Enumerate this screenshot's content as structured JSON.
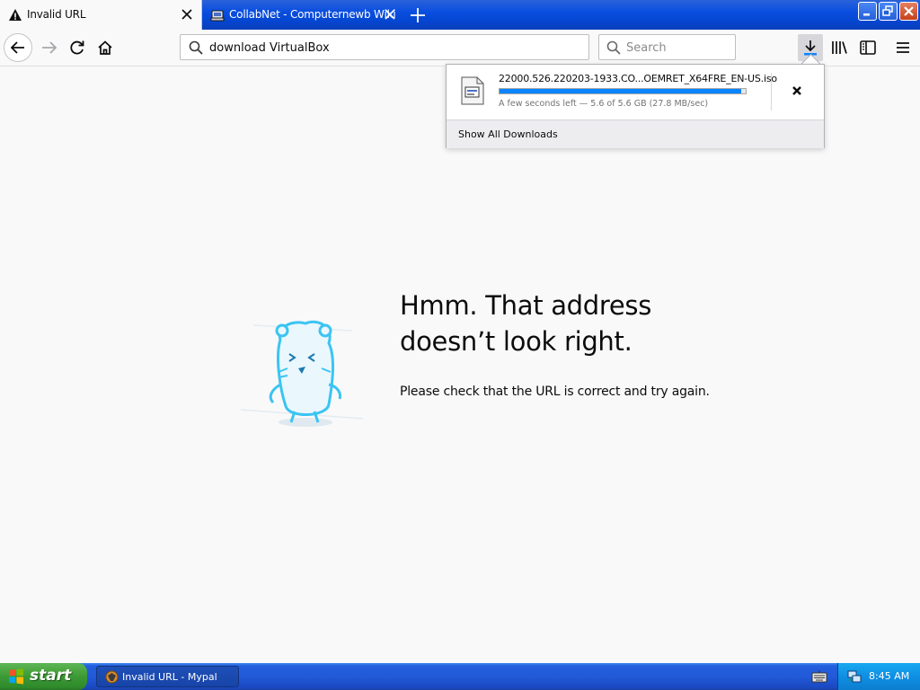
{
  "browser": {
    "tabs": [
      {
        "title": "Invalid URL",
        "icon": "warning-icon",
        "active": true
      },
      {
        "title": "CollabNet - Computernewb Wiki",
        "icon": "wiki-favicon-icon",
        "active": false
      }
    ],
    "url": "download VirtualBox",
    "search_placeholder": "Search"
  },
  "downloads_panel": {
    "filename": "22000.526.220203-1933.CO...OEMRET_X64FRE_EN-US.iso",
    "progress": 0.98,
    "status": "A few seconds left — 5.6 of 5.6 GB (27.8 MB/sec)",
    "show_all_label": "Show All Downloads"
  },
  "page": {
    "title": "Hmm. That address doesn’t look right.",
    "description": "Please check that the URL is correct and try again."
  },
  "taskbar": {
    "start_label": "start",
    "task_label": "Invalid URL - Mypal",
    "clock": "8:45 AM"
  },
  "colors": {
    "accent": "#0a84ff",
    "xp_blue": "#245edc",
    "start_green": "#3c9a35"
  }
}
